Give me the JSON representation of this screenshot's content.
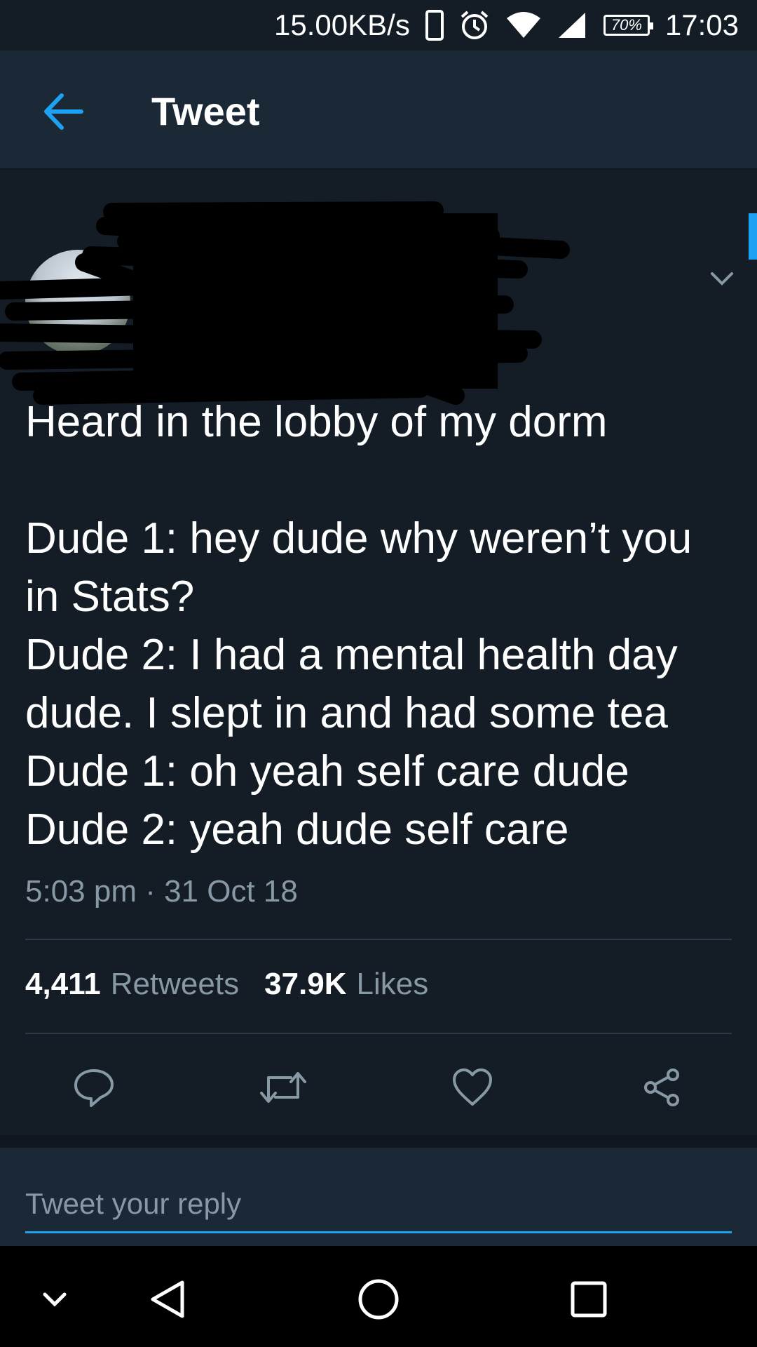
{
  "status_bar": {
    "speed": "15.00KB/s",
    "battery": "70%",
    "time": "17:03"
  },
  "app_bar": {
    "title": "Tweet"
  },
  "tweet": {
    "text": "Heard in the lobby of my dorm\n\nDude 1: hey dude why weren’t you in Stats?\nDude 2: I had a mental health day dude. I slept in and had some tea\nDude 1: oh yeah self care dude\nDude 2: yeah dude self care",
    "timestamp": "5:03 pm · 31 Oct 18",
    "retweets_count": "4,411",
    "retweets_label": "Retweets",
    "likes_count": "37.9K",
    "likes_label": "Likes"
  },
  "reply": {
    "placeholder": "Tweet your reply"
  },
  "colors": {
    "accent": "#1da1f2",
    "background": "#141d26",
    "surface": "#1b2836",
    "muted_text": "#8899a6"
  },
  "icons": {
    "back": "arrow-left-icon",
    "caret": "chevron-down-icon",
    "reply": "speech-bubble-icon",
    "retweet": "retweet-icon",
    "like": "heart-icon",
    "share": "share-icon"
  }
}
